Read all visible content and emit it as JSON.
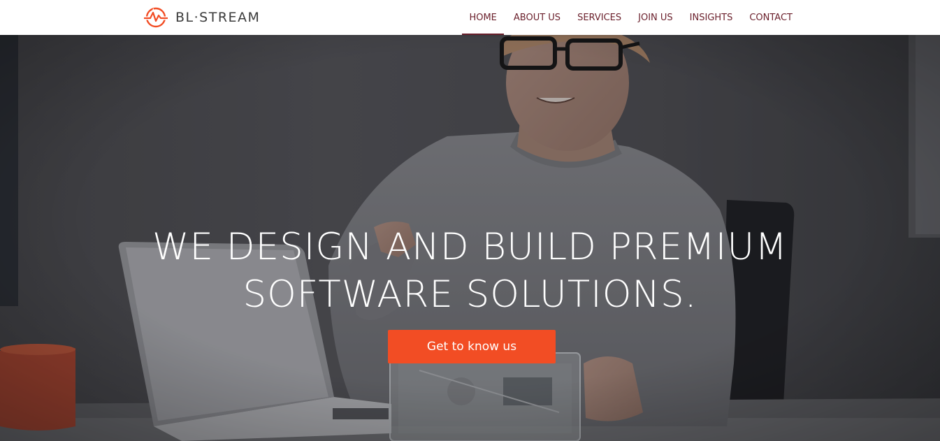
{
  "brand": {
    "name": "BL·STREAM",
    "logo_icon": "bl-stream-logo-icon",
    "accent_color": "#f24d24",
    "nav_color": "#6a1f2b"
  },
  "nav": {
    "items": [
      {
        "label": "HOME",
        "active": true
      },
      {
        "label": "ABOUT US",
        "active": false
      },
      {
        "label": "SERVICES",
        "active": false
      },
      {
        "label": "JOIN US",
        "active": false
      },
      {
        "label": "INSIGHTS",
        "active": false
      },
      {
        "label": "CONTACT",
        "active": false
      }
    ]
  },
  "hero": {
    "title_line1": "WE DESIGN AND BUILD PREMIUM",
    "title_line2": "SOFTWARE SOLUTIONS.",
    "cta_label": "Get to know us",
    "background_image": "man-at-desk-with-laptop-and-device"
  }
}
